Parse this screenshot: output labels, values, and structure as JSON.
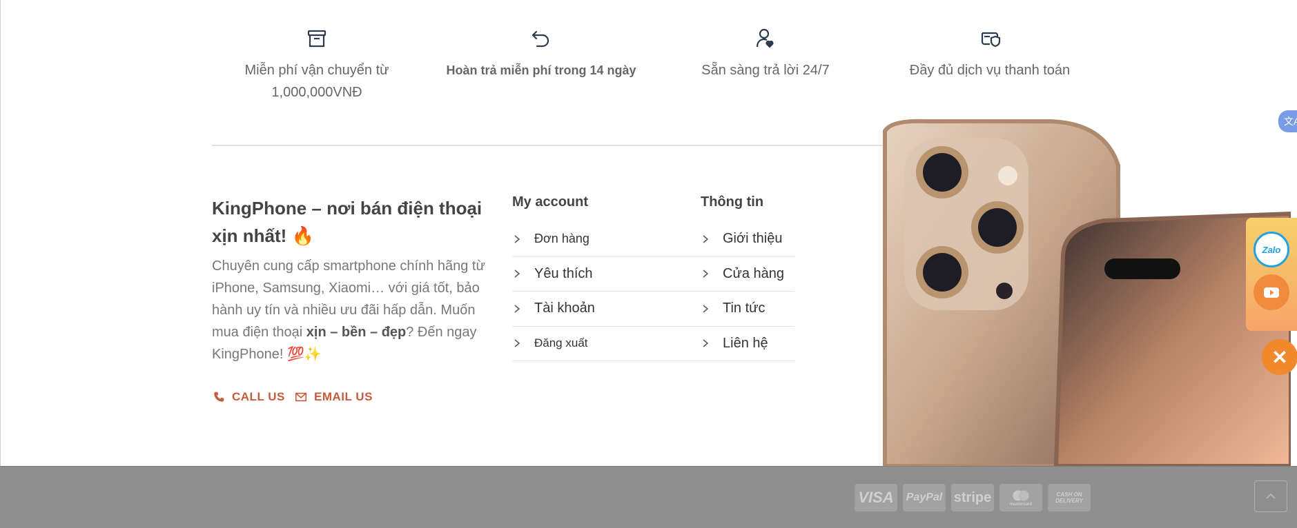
{
  "features": [
    {
      "icon": "box-icon",
      "text_line1": "Miễn phí vận chuyển từ",
      "text_line2": "1,000,000VNĐ"
    },
    {
      "icon": "undo-icon",
      "text_line1": "Hoàn trả miễn phí trong 14 ngày"
    },
    {
      "icon": "user-heart-icon",
      "text_line1": "Sẵn sàng trả lời 24/7"
    },
    {
      "icon": "wallet-shield-icon",
      "text_line1": "Đầy đủ dịch vụ thanh toán"
    }
  ],
  "about": {
    "title": "KingPhone – nơi bán điện thoại xịn nhất! 🔥",
    "desc_part1": "Chuyên cung cấp smartphone chính hãng từ iPhone, Samsung, Xiaomi… với giá tốt, bảo hành uy tín và nhiều ưu đãi hấp dẫn. Muốn mua điện thoại ",
    "desc_bold": "xịn – bền – đẹp",
    "desc_part2": "? Đến ngay KingPhone! 💯✨",
    "call_label": "CALL US",
    "email_label": "EMAIL US"
  },
  "my_account": {
    "title": "My account",
    "items": [
      "Đơn hàng",
      "Yêu thích",
      "Tài khoản",
      "Đăng xuất"
    ]
  },
  "info": {
    "title": "Thông tin",
    "items": [
      "Giới thiệu",
      "Cửa hàng",
      "Tin tức",
      "Liên hệ"
    ]
  },
  "floating": {
    "translate_label": "文A",
    "zalo_label": "Zalo"
  },
  "payments": [
    "VISA",
    "PayPal",
    "stripe",
    "mastercard",
    "CASH ON DELIVERY"
  ],
  "colors": {
    "accent": "#c85a3c",
    "float_orange": "#f08a2c",
    "bottom_bar": "#8f8f8f"
  }
}
